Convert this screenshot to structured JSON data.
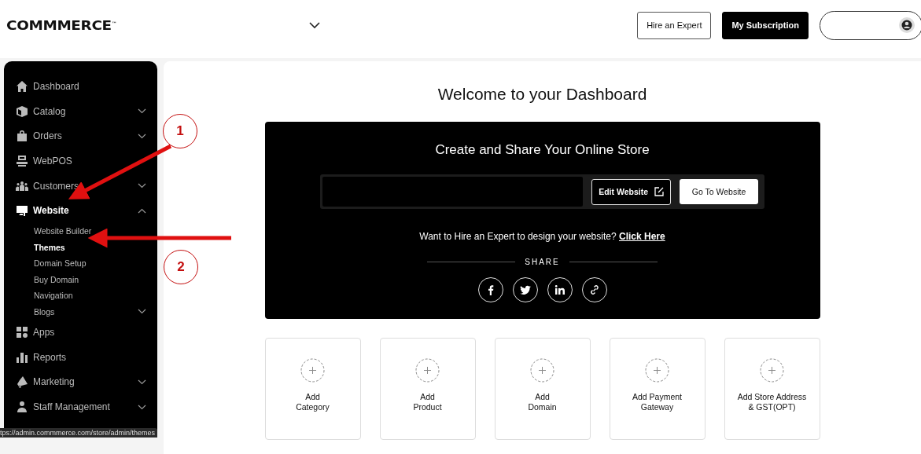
{
  "header": {
    "logo": "COMMMERCE",
    "logo_mark": "™",
    "buttons": [
      {
        "label": "Hire an Expert",
        "kind": "outline"
      },
      {
        "label": "My Subscription",
        "kind": "solid"
      }
    ]
  },
  "sidebar": {
    "items": [
      {
        "label": "Dashboard",
        "expandable": false,
        "selected": false
      },
      {
        "label": "Catalog",
        "expandable": true,
        "expanded": false,
        "selected": false
      },
      {
        "label": "Orders",
        "expandable": true,
        "expanded": false,
        "selected": false
      },
      {
        "label": "WebPOS",
        "expandable": false,
        "selected": false
      },
      {
        "label": "Customers",
        "expandable": true,
        "expanded": false,
        "selected": false
      },
      {
        "label": "Website",
        "expandable": true,
        "expanded": true,
        "selected": true,
        "children": [
          {
            "label": "Website Builder",
            "selected": false,
            "expandable": false
          },
          {
            "label": "Themes",
            "selected": true,
            "expandable": false
          },
          {
            "label": "Domain Setup",
            "selected": false,
            "expandable": false
          },
          {
            "label": "Buy Domain",
            "selected": false,
            "expandable": false
          },
          {
            "label": "Navigation",
            "selected": false,
            "expandable": false
          },
          {
            "label": "Blogs",
            "selected": false,
            "expandable": true
          }
        ]
      },
      {
        "label": "Apps",
        "expandable": false,
        "selected": false
      },
      {
        "label": "Reports",
        "expandable": false,
        "selected": false
      },
      {
        "label": "Marketing",
        "expandable": true,
        "expanded": false,
        "selected": false
      },
      {
        "label": "Staff Management",
        "expandable": true,
        "expanded": false,
        "selected": false
      }
    ]
  },
  "main": {
    "title": "Welcome to your Dashboard",
    "store_card": {
      "title": "Create and Share Your Online Store",
      "edit_button": "Edit Website",
      "go_button": "Go To Website",
      "hire_text": "Want to Hire an Expert to design your website?",
      "hire_link": "Click Here",
      "share_label": "SHARE",
      "share": [
        {
          "kind": "facebook"
        },
        {
          "kind": "twitter"
        },
        {
          "kind": "linkedin"
        },
        {
          "kind": "link"
        }
      ]
    },
    "quick_actions": [
      {
        "lines": [
          "Add",
          "Category"
        ]
      },
      {
        "lines": [
          "Add",
          "Product"
        ]
      },
      {
        "lines": [
          "Add",
          "Domain"
        ]
      },
      {
        "lines": [
          "Add Payment",
          "Gateway"
        ]
      },
      {
        "lines": [
          "Add Store Address",
          "& GST(OPT)"
        ]
      }
    ]
  },
  "annotations": [
    {
      "number": "1"
    },
    {
      "number": "2"
    }
  ],
  "status_url": "tps://admin.commmerce.com/store/admin/themes"
}
